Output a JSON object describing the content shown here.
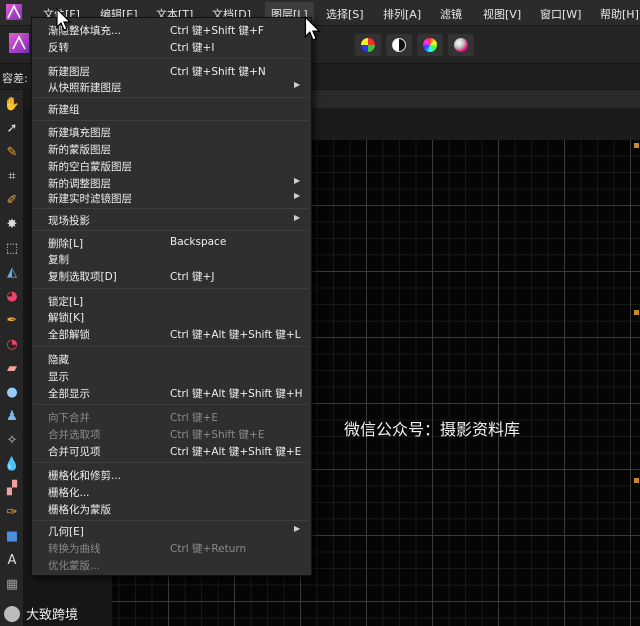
{
  "menubar": {
    "items": [
      {
        "label": "文件[F]"
      },
      {
        "label": "编辑[E]"
      },
      {
        "label": "文本[T]"
      },
      {
        "label": "文档[D]"
      },
      {
        "label": "图层[L]"
      },
      {
        "label": "选择[S]"
      },
      {
        "label": "排列[A]"
      },
      {
        "label": "滤镜"
      },
      {
        "label": "视图[V]"
      },
      {
        "label": "窗口[W]"
      },
      {
        "label": "帮助[H]"
      }
    ]
  },
  "context_toolbar": {
    "tolerance_label": "容差:"
  },
  "layer_menu": {
    "items": [
      {
        "label": "渐隐整体填充...",
        "shortcut": "Ctrl 键+Shift 键+F"
      },
      {
        "label": "反转",
        "shortcut": "Ctrl 键+I"
      },
      {
        "label": "新建图层",
        "shortcut": "Ctrl 键+Shift 键+N"
      },
      {
        "label": "从快照新建图层",
        "shortcut": ""
      },
      {
        "label": "新建组",
        "shortcut": ""
      },
      {
        "label": "新建填充图层",
        "shortcut": ""
      },
      {
        "label": "新的蒙版图层",
        "shortcut": ""
      },
      {
        "label": "新的空白蒙版图层",
        "shortcut": ""
      },
      {
        "label": "新的调整图层",
        "shortcut": ""
      },
      {
        "label": "新建实时滤镜图层",
        "shortcut": ""
      },
      {
        "label": "现场投影",
        "shortcut": ""
      },
      {
        "label": "删除[L]",
        "shortcut": "Backspace"
      },
      {
        "label": "复制",
        "shortcut": ""
      },
      {
        "label": "复制选取项[D]",
        "shortcut": "Ctrl 键+J"
      },
      {
        "label": "锁定[L]",
        "shortcut": ""
      },
      {
        "label": "解锁[K]",
        "shortcut": ""
      },
      {
        "label": "全部解锁",
        "shortcut": "Ctrl 键+Alt 键+Shift 键+L"
      },
      {
        "label": "隐藏",
        "shortcut": ""
      },
      {
        "label": "显示",
        "shortcut": ""
      },
      {
        "label": "全部显示",
        "shortcut": "Ctrl 键+Alt 键+Shift 键+H"
      },
      {
        "label": "向下合并",
        "shortcut": "Ctrl 键+E"
      },
      {
        "label": "合并选取项",
        "shortcut": "Ctrl 键+Shift 键+E"
      },
      {
        "label": "合并可见项",
        "shortcut": "Ctrl 键+Alt 键+Shift 键+E"
      },
      {
        "label": "栅格化和修剪...",
        "shortcut": ""
      },
      {
        "label": "栅格化...",
        "shortcut": ""
      },
      {
        "label": "栅格化为蒙版",
        "shortcut": ""
      },
      {
        "label": "几何[E]",
        "shortcut": ""
      },
      {
        "label": "转换为曲线",
        "shortcut": "Ctrl 键+Return"
      },
      {
        "label": "优化蒙版...",
        "shortcut": ""
      }
    ]
  },
  "watermark": "微信公众号：摄影资料库",
  "brand": "大致跨境",
  "colors": {
    "accent": "#c98a2d",
    "menu_bg": "#2f2f2f",
    "canvas_bg": "#050505"
  }
}
